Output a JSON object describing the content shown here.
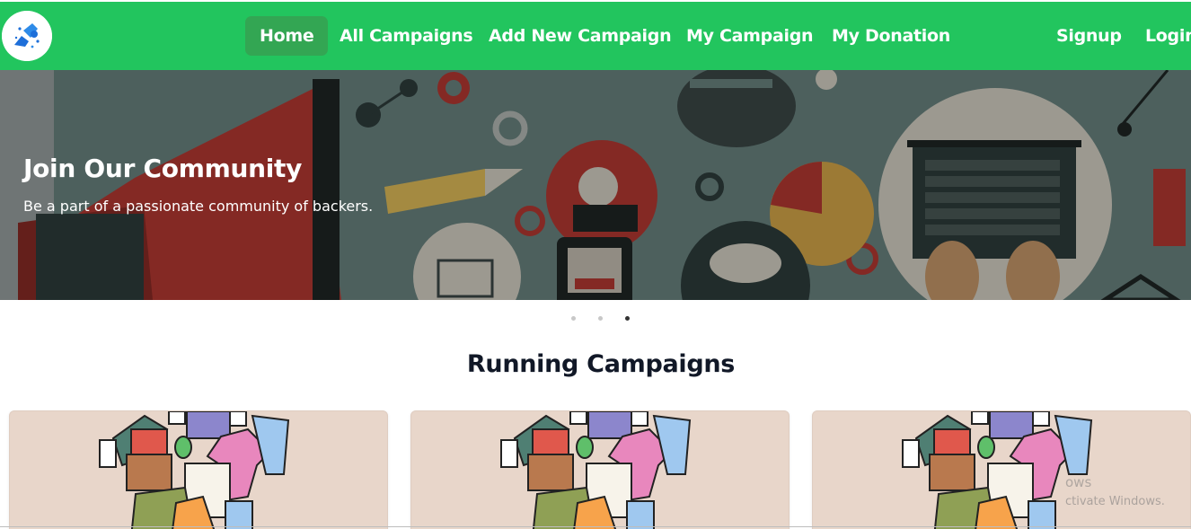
{
  "nav": {
    "links": [
      "Home",
      "All Campaigns",
      "Add New Campaign",
      "My Campaign",
      "My Donation"
    ],
    "auth": [
      "Signup",
      "Login"
    ],
    "active": "Home",
    "logo_icon": "crowdfunding-hands-logo-icon"
  },
  "hero": {
    "title": "Join Our Community",
    "subtitle": "Be a part of a passionate community of backers.",
    "slide_count": 3,
    "active_slide": 3
  },
  "section": {
    "title": "Running Campaigns"
  },
  "cards": [
    {
      "image": "clothes-donation-illustration"
    },
    {
      "image": "clothes-donation-illustration"
    },
    {
      "image": "clothes-donation-illustration"
    }
  ],
  "watermark": {
    "line1": "ows",
    "line2": "ctivate Windows."
  },
  "colors": {
    "nav_bg": "#22c55e",
    "nav_active": "#33a653",
    "card_bg": "#e8d6ca",
    "heading": "#111827"
  }
}
